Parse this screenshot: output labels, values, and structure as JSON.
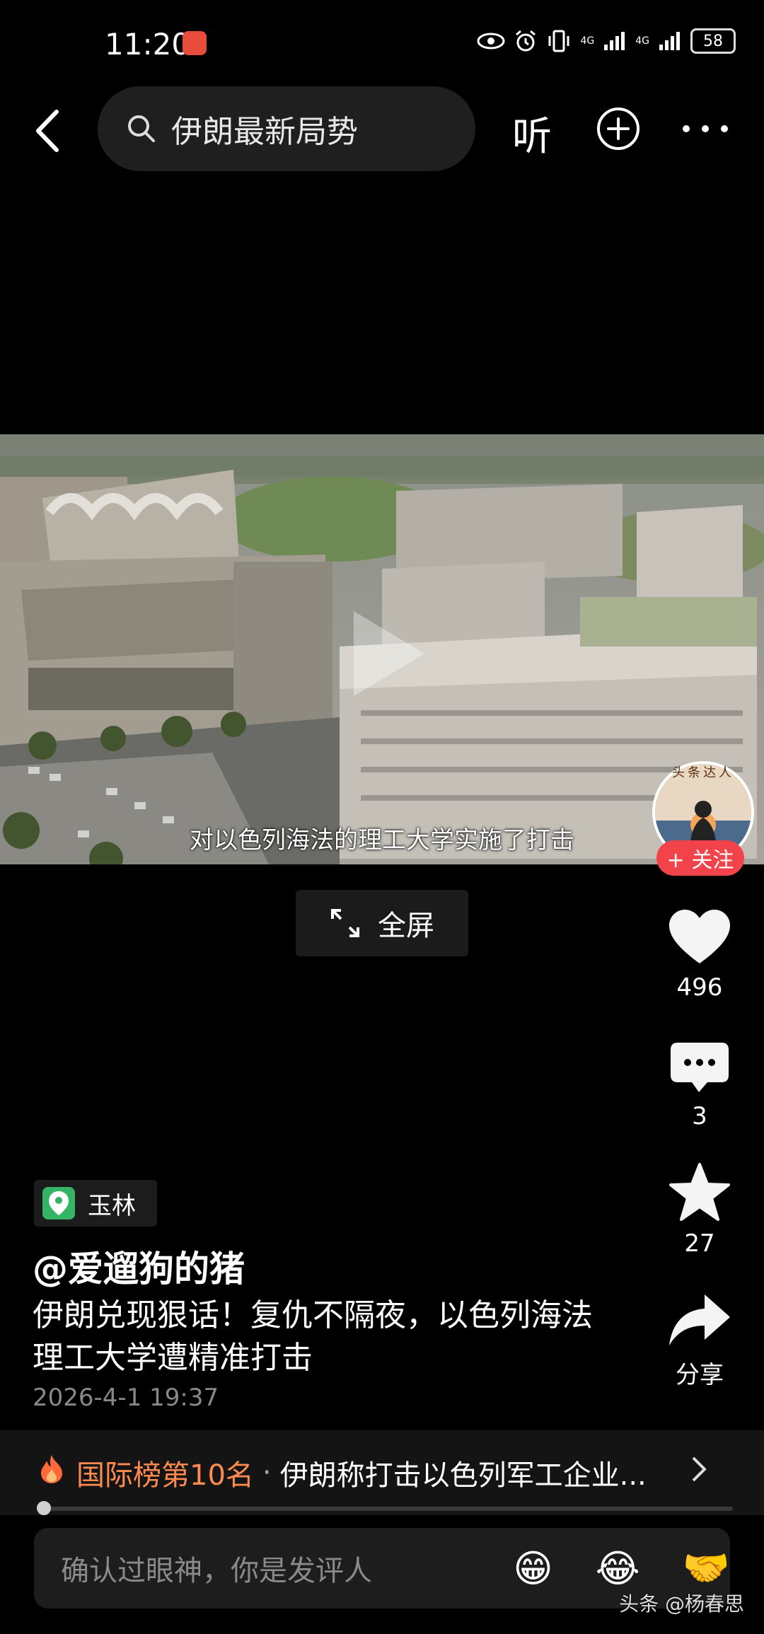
{
  "status_bar": {
    "time": "11:20",
    "network_1": "4G",
    "network_2": "4G",
    "battery": "58"
  },
  "top_bar": {
    "search_text": "伊朗最新局势",
    "listen_label": "听"
  },
  "video": {
    "subtitle": "对以色列海法的理工大学实施了打击",
    "avatar_banner": "头条达人",
    "follow_label": "+ 关注",
    "fullscreen_label": "全屏"
  },
  "actions": {
    "likes": "496",
    "comments": "3",
    "favorites": "27",
    "share_label": "分享"
  },
  "post": {
    "location": "玉林",
    "author": "@爱遛狗的猪",
    "description": "伊朗兑现狠话！复仇不隔夜，以色列海法理工大学遭精准打击",
    "date": "2026-4-1 19:37"
  },
  "ranking": {
    "label": "国际榜第10名",
    "separator": "·",
    "title": "伊朗称打击以色列军工企业..."
  },
  "playback": {
    "progress": 0.01
  },
  "comment_bar": {
    "placeholder": "确认过眼神，你是发评人",
    "emojis": [
      "😁",
      "😂",
      "🤝"
    ]
  },
  "watermark": "头条 @杨春思",
  "colors": {
    "follow_red": "#f2434b",
    "rank_orange": "#ff8a50",
    "location_green": "#34b464"
  }
}
